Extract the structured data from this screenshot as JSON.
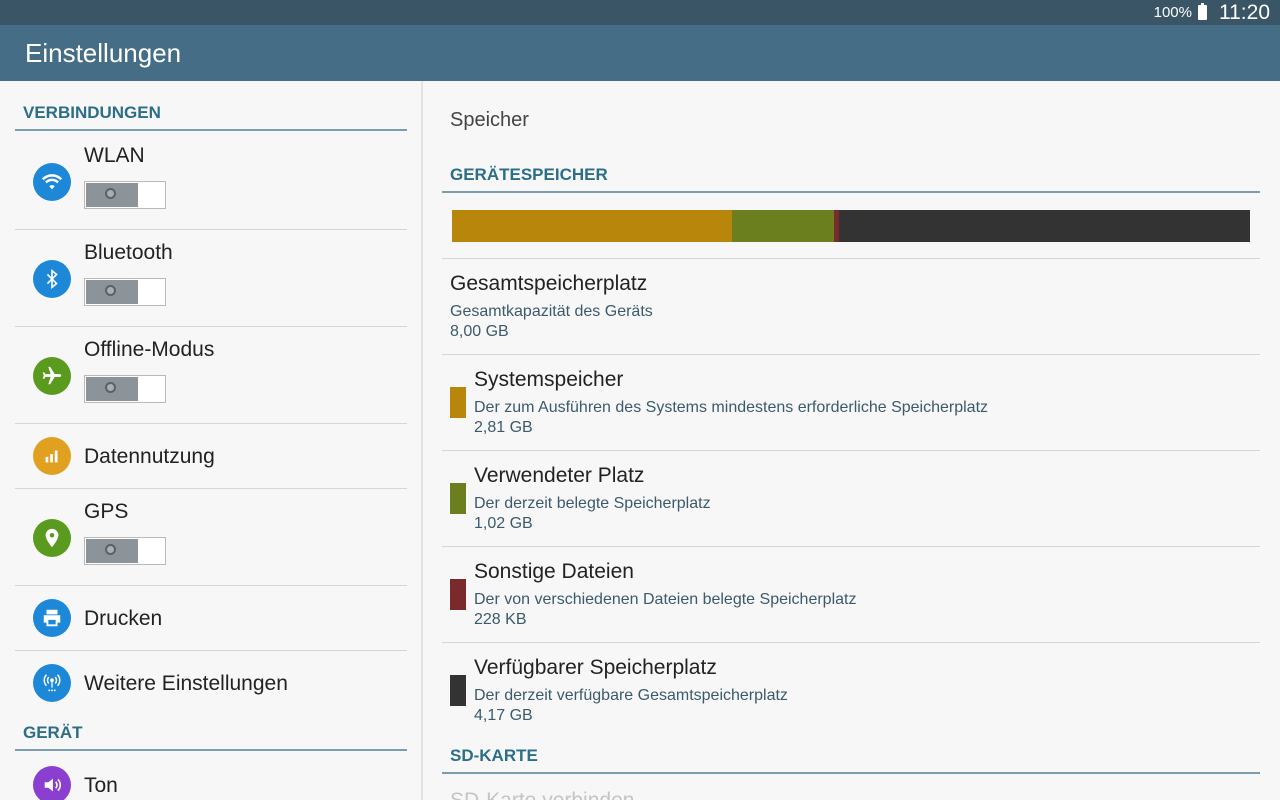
{
  "status_bar": {
    "battery": "100%",
    "time": "11:20"
  },
  "action_bar": {
    "title": "Einstellungen"
  },
  "sidebar": {
    "sections": [
      {
        "label": "VERBINDUNGEN"
      },
      {
        "label": "GERÄT"
      }
    ],
    "items": [
      {
        "label": "WLAN",
        "icon": "wifi-icon",
        "color": "#1e88d8",
        "toggle": false
      },
      {
        "label": "Bluetooth",
        "icon": "bluetooth-icon",
        "color": "#1e88d8",
        "toggle": false
      },
      {
        "label": "Offline-Modus",
        "icon": "airplane-icon",
        "color": "#5a9a1f",
        "toggle": false
      },
      {
        "label": "Datennutzung",
        "icon": "data-usage-icon",
        "color": "#e0a020"
      },
      {
        "label": "GPS",
        "icon": "location-pin-icon",
        "color": "#5a9a1f",
        "toggle": false
      },
      {
        "label": "Drucken",
        "icon": "printer-icon",
        "color": "#1e88d8"
      },
      {
        "label": "Weitere Einstellungen",
        "icon": "antenna-icon",
        "color": "#1e88d8"
      },
      {
        "label": "Ton",
        "icon": "speaker-icon",
        "color": "#8a3fd0"
      }
    ]
  },
  "storage": {
    "page_title": "Speicher",
    "device_section": "GERÄTESPEICHER",
    "sd_section": "SD-KARTE",
    "total": {
      "title": "Gesamtspeicherplatz",
      "subtitle": "Gesamtkapazität des Geräts",
      "value": "8,00 GB"
    },
    "items": [
      {
        "title": "Systemspeicher",
        "subtitle": "Der zum Ausführen des Systems mindestens erforderliche Speicherplatz",
        "value": "2,81 GB",
        "color": "#b8860b",
        "fraction": 0.351
      },
      {
        "title": "Verwendeter Platz",
        "subtitle": "Der derzeit belegte Speicherplatz",
        "value": "1,02 GB",
        "color": "#6b7f1f",
        "fraction": 0.1275
      },
      {
        "title": "Sonstige Dateien",
        "subtitle": "Der von verschiedenen Dateien belegte Speicherplatz",
        "value": "228 KB",
        "color": "#7a2a2a",
        "fraction": 0.006
      },
      {
        "title": "Verfügbarer Speicherplatz",
        "subtitle": "Der derzeit verfügbare Gesamtspeicherplatz",
        "value": "4,17 GB",
        "color": "#333333",
        "fraction": 0.5155
      }
    ],
    "sd_connect": "SD-Karte verbinden"
  }
}
